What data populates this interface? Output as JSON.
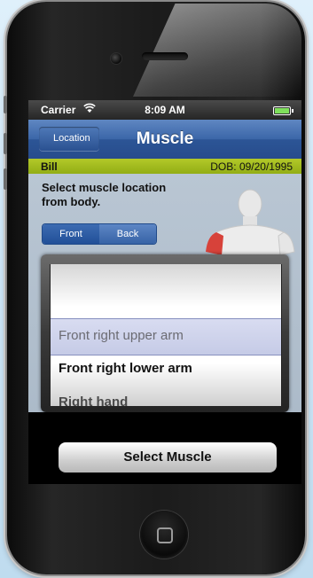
{
  "status_bar": {
    "carrier": "Carrier",
    "time": "8:09 AM"
  },
  "nav": {
    "back_label": "Location",
    "title": "Muscle"
  },
  "patient": {
    "name": "Bill",
    "dob": "DOB: 09/20/1995"
  },
  "instructions": "Select muscle location from body.",
  "segmented": {
    "front": "Front",
    "back": "Back",
    "selected": "Front"
  },
  "picker": {
    "items": [
      "Front right upper arm",
      "Front right lower arm",
      "Right hand"
    ],
    "selected_index": 0
  },
  "actions": {
    "select_label": "Select Muscle"
  },
  "colors": {
    "nav_blue": "#2c5596",
    "patient_bar": "#a6bd1e",
    "highlight": "#d7423a"
  }
}
